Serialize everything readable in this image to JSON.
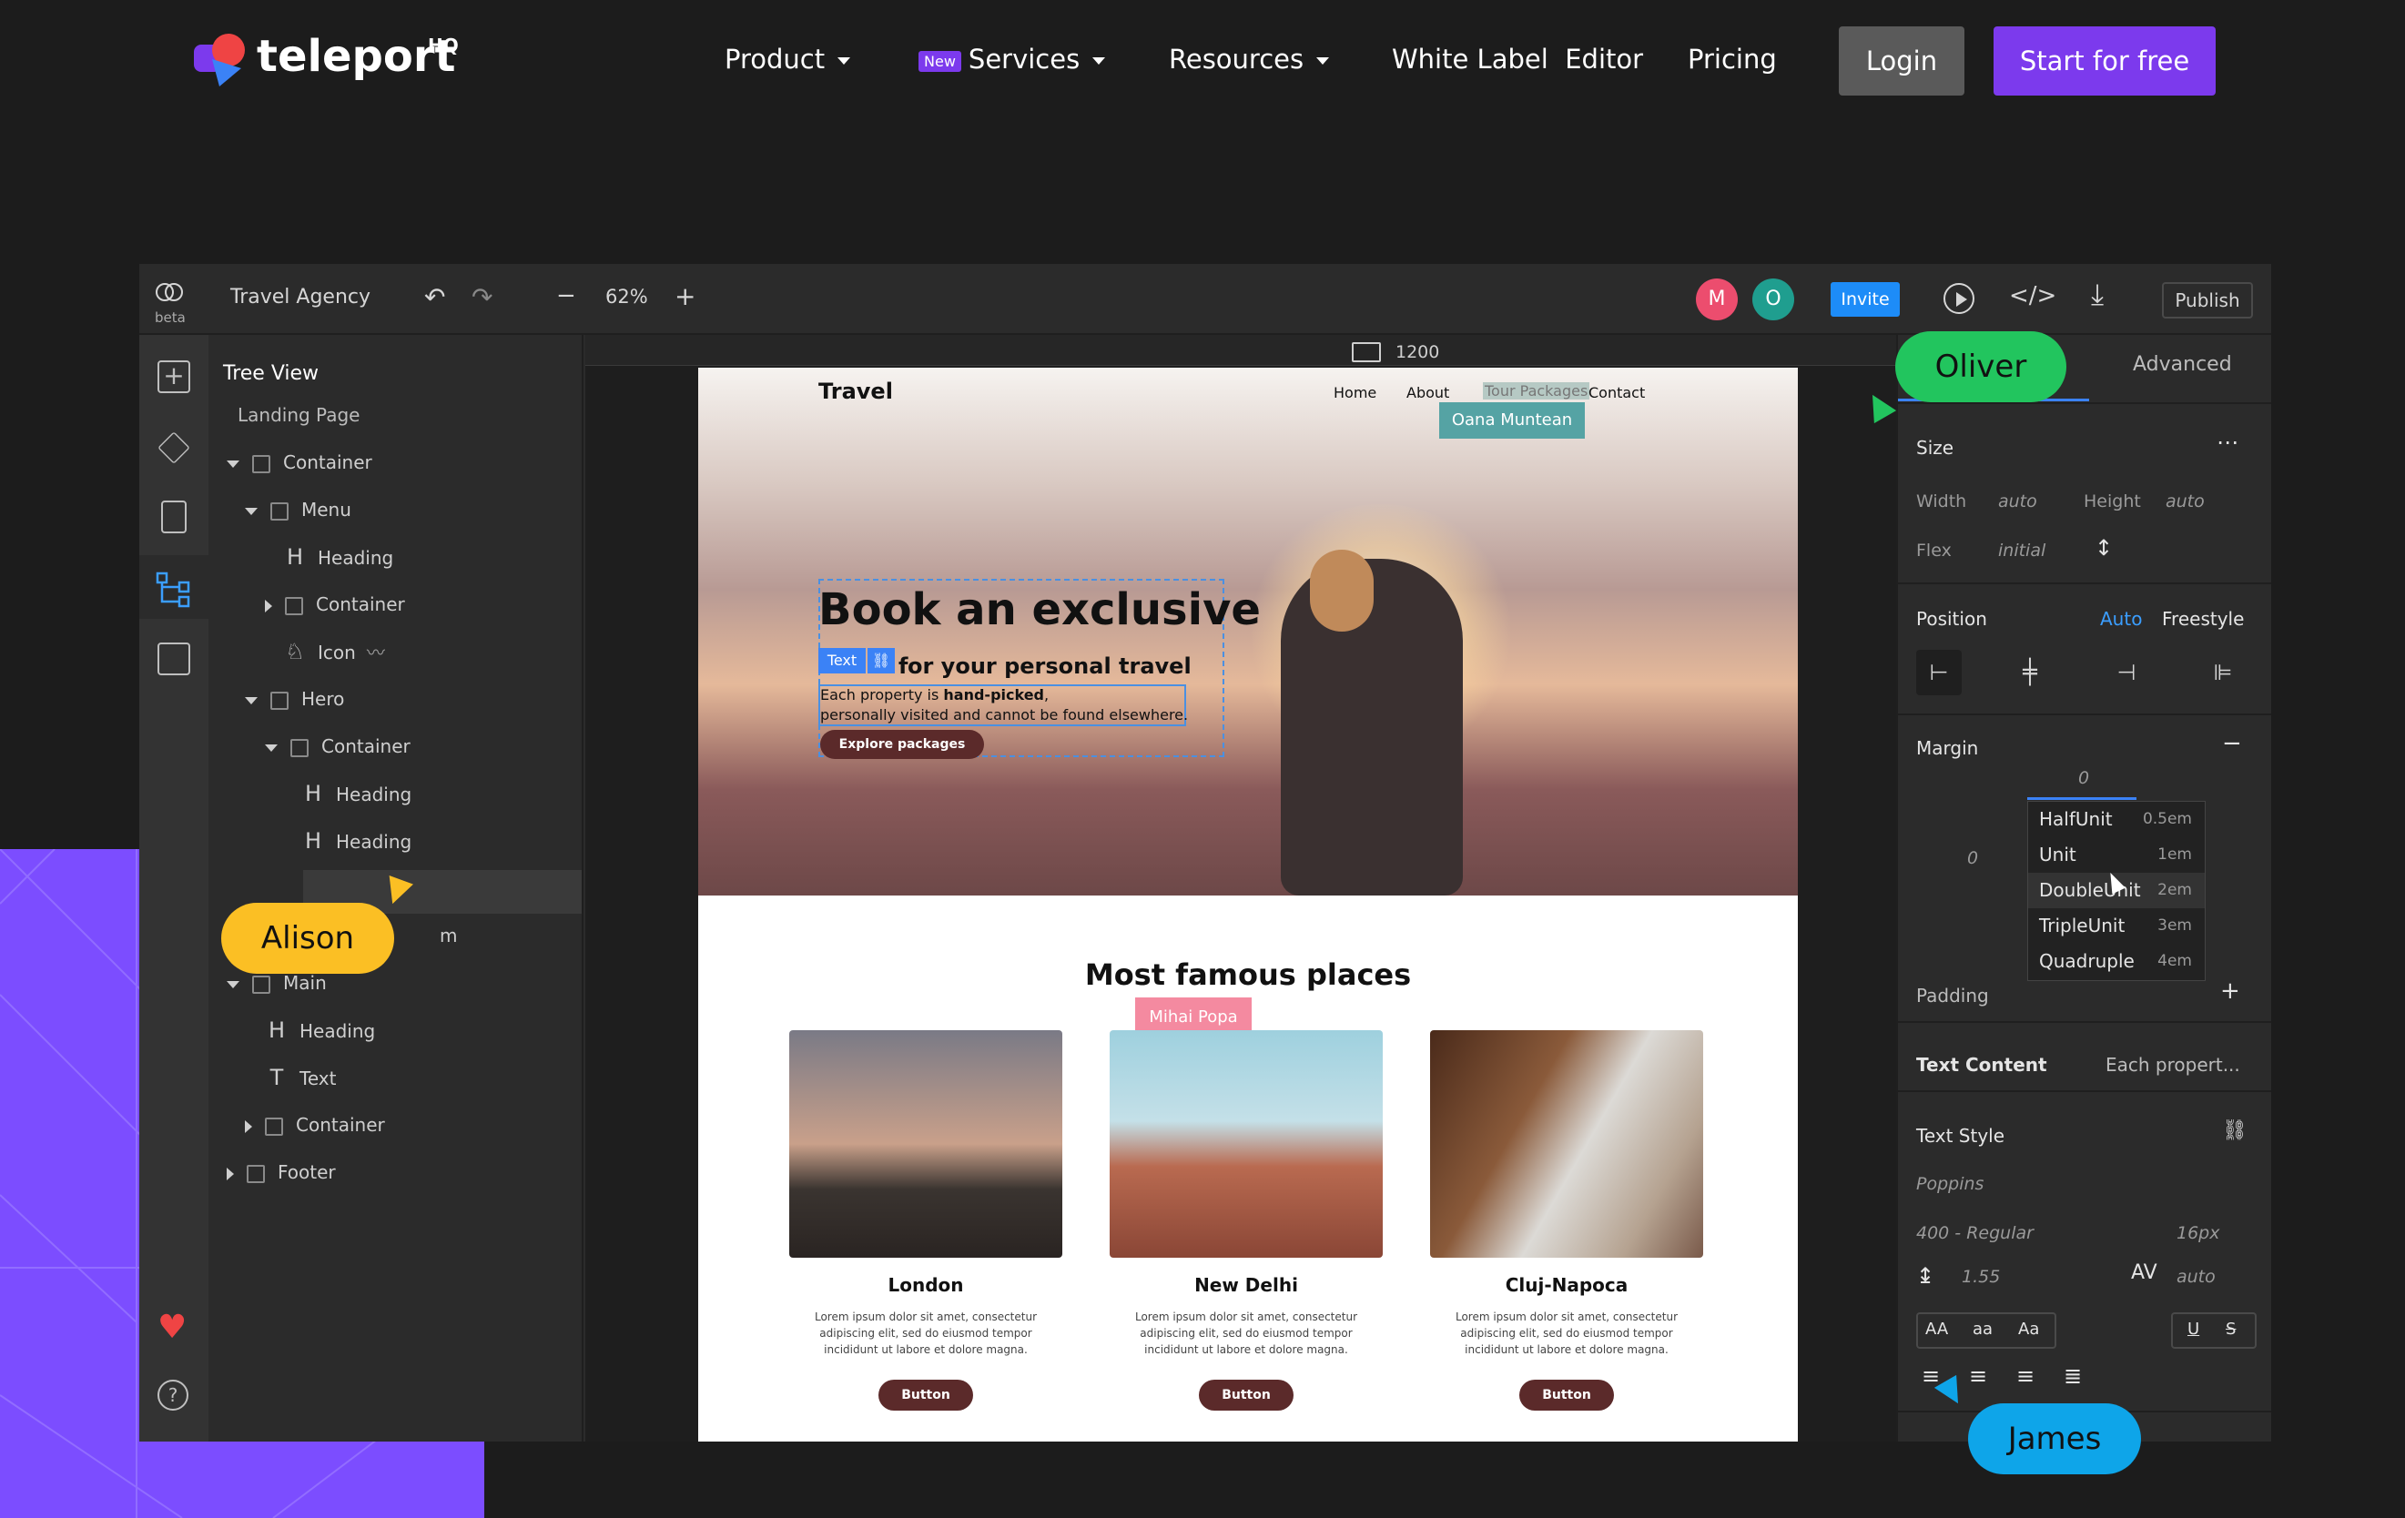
{
  "nav": {
    "brand": "teleport",
    "brand_sup": "HQ",
    "product": "Product",
    "services_badge": "New",
    "services": "Services",
    "resources": "Resources",
    "white_label": "White Label  Editor",
    "pricing": "Pricing",
    "login": "Login",
    "start": "Start for free"
  },
  "toolbar": {
    "logo_sub": "beta",
    "project": "Travel Agency",
    "zoom": "62%",
    "avatar_m": "M",
    "avatar_o": "O",
    "invite": "Invite",
    "publish": "Publish",
    "viewport": "1200"
  },
  "tree": {
    "title": "Tree View",
    "page": "Landing Page",
    "rows": [
      "Container",
      "Menu",
      "Heading",
      "Container",
      "Icon",
      "Hero",
      "Container",
      "Heading",
      "Heading",
      "Main",
      "Heading",
      "Text",
      "Container",
      "Footer"
    ],
    "partial_row": "m"
  },
  "canvas": {
    "logo": "Travel",
    "menu": [
      "Home",
      "About",
      "Tour Packages",
      "Contact"
    ],
    "user_tag_1": "Oana Muntean",
    "hero_heading": "Book an exclusive",
    "hero_sub": "or your personal travel",
    "hero_sub_prefix": "f",
    "text_badge": "Text",
    "hero_body_1a": "Each property is ",
    "hero_body_1b": "hand-picked",
    "hero_body_1c": ",",
    "hero_body_2": "personally visited and cannot be found elsewhere.",
    "hero_button": "Explore packages",
    "places_title": "Most famous places",
    "user_tag_2": "Mihai Popa",
    "cards": [
      {
        "title": "London",
        "body": "Lorem ipsum dolor sit amet, consectetur adipiscing elit, sed do eiusmod tempor incididunt ut labore et dolore magna.",
        "button": "Button"
      },
      {
        "title": "New Delhi",
        "body": "Lorem ipsum dolor sit amet, consectetur adipiscing elit, sed do eiusmod tempor incididunt ut labore et dolore magna.",
        "button": "Button"
      },
      {
        "title": "Cluj-Napoca",
        "body": "Lorem ipsum dolor sit amet, consectetur adipiscing elit, sed do eiusmod tempor incididunt ut labore et dolore magna.",
        "button": "Button"
      }
    ]
  },
  "panel": {
    "tab_advanced": "Advanced",
    "size": "Size",
    "width_label": "Width",
    "width_val": "auto",
    "height_label": "Height",
    "height_val": "auto",
    "flex_label": "Flex",
    "flex_val": "initial",
    "position": "Position",
    "pos_auto": "Auto",
    "pos_free": "Freestyle",
    "margin": "Margin",
    "margin_top": "0",
    "margin_left": "0",
    "dropdown": [
      {
        "name": "HalfUnit",
        "value": "0.5em"
      },
      {
        "name": "Unit",
        "value": "1em"
      },
      {
        "name": "DoubleUnit",
        "value": "2em"
      },
      {
        "name": "TripleUnit",
        "value": "3em"
      },
      {
        "name": "Quadruple",
        "value": "4em"
      }
    ],
    "padding": "Padding",
    "text_content": "Text Content",
    "text_content_val": "Each propert...",
    "text_style": "Text Style",
    "font": "Poppins",
    "weight": "400 - Regular",
    "size_px": "16px",
    "line_height": "1.55",
    "letter_spacing": "auto",
    "case_aa": "AA",
    "case_lower": "aa",
    "case_title": "Aa",
    "underline": "U",
    "strike": "S"
  },
  "cursors": {
    "oliver": "Oliver",
    "alison": "Alison",
    "james": "James"
  },
  "colors": {
    "accent": "#7c3aed",
    "oliver": "#22c55e",
    "alison": "#fbbf24",
    "james": "#0ea5e9",
    "invite": "#1d8cf8"
  }
}
